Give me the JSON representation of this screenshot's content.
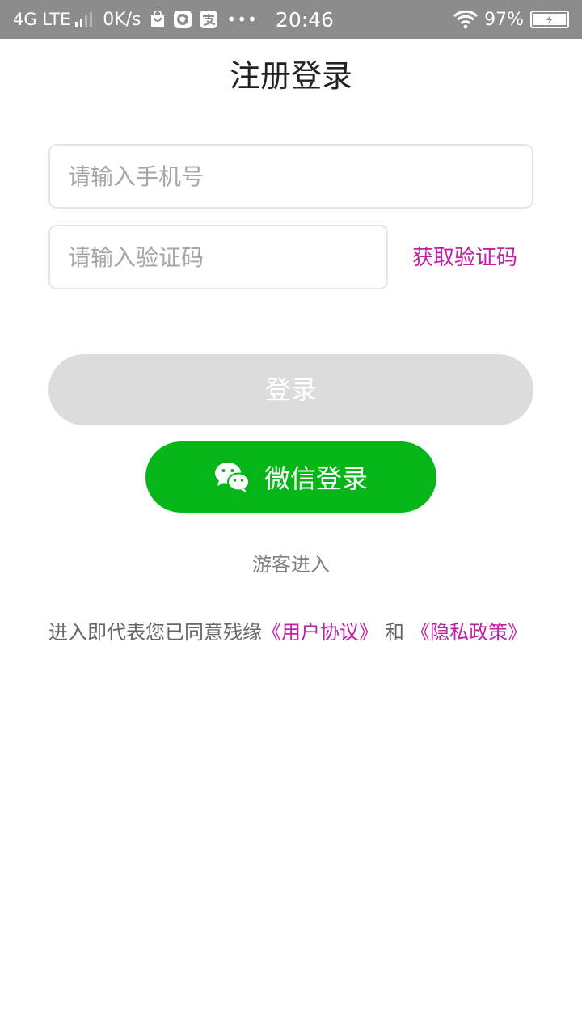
{
  "status_bar": {
    "network": "4G LTE",
    "speed": "0K/s",
    "more": "•••",
    "time": "20:46",
    "battery": "97%"
  },
  "header": {
    "title": "注册登录"
  },
  "form": {
    "phone_placeholder": "请输入手机号",
    "code_placeholder": "请输入验证码",
    "get_code_label": "获取验证码"
  },
  "actions": {
    "login_label": "登录",
    "wechat_label": "微信登录",
    "guest_label": "游客进入"
  },
  "agreement": {
    "prefix": "进入即代表您已同意残缘",
    "user_agreement": "《用户协议》",
    "and": "和",
    "privacy_policy": "《隐私政策》"
  },
  "colors": {
    "status_bar_bg": "#8c8c8c",
    "accent_link": "#c020a6",
    "wechat_green": "#06b518",
    "login_disabled": "#dcdcdc"
  },
  "icons": [
    "signal-icon",
    "bag-icon",
    "browser-icon",
    "alipay-icon",
    "wifi-icon",
    "battery-icon",
    "wechat-icon"
  ]
}
